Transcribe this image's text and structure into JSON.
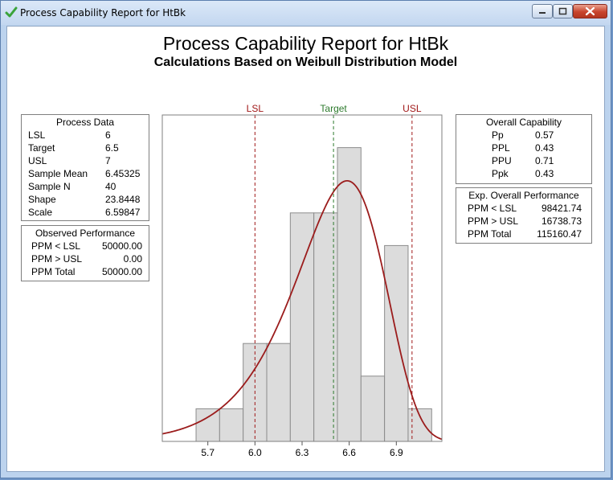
{
  "window": {
    "title": "Process Capability Report for HtBk"
  },
  "report": {
    "title": "Process Capability Report for HtBk",
    "subtitle": "Calculations Based on Weibull Distribution Model"
  },
  "process_data": {
    "title": "Process Data",
    "rows": [
      {
        "label": "LSL",
        "value": "6"
      },
      {
        "label": "Target",
        "value": "6.5"
      },
      {
        "label": "USL",
        "value": "7"
      },
      {
        "label": "Sample Mean",
        "value": "6.45325"
      },
      {
        "label": "Sample N",
        "value": "40"
      },
      {
        "label": "Shape",
        "value": "23.8448"
      },
      {
        "label": "Scale",
        "value": "6.59847"
      }
    ]
  },
  "observed_performance": {
    "title": "Observed Performance",
    "rows": [
      {
        "label": "PPM < LSL",
        "value": "50000.00"
      },
      {
        "label": "PPM > USL",
        "value": "0.00"
      },
      {
        "label": "PPM Total",
        "value": "50000.00"
      }
    ]
  },
  "overall_capability": {
    "title": "Overall Capability",
    "rows": [
      {
        "label": "Pp",
        "value": "0.57"
      },
      {
        "label": "PPL",
        "value": "0.43"
      },
      {
        "label": "PPU",
        "value": "0.71"
      },
      {
        "label": "Ppk",
        "value": "0.43"
      }
    ]
  },
  "exp_overall_performance": {
    "title": "Exp. Overall Performance",
    "rows": [
      {
        "label": "PPM < LSL",
        "value": "98421.74"
      },
      {
        "label": "PPM > USL",
        "value": "16738.73"
      },
      {
        "label": "PPM Total",
        "value": "115160.47"
      }
    ]
  },
  "chart_data": {
    "type": "bar",
    "title": "Process Capability Report for HtBk",
    "subtitle": "Calculations Based on Weibull Distribution Model",
    "bin_width": 0.15,
    "bins": [
      {
        "start": 5.625,
        "count": 1
      },
      {
        "start": 5.775,
        "count": 1
      },
      {
        "start": 5.925,
        "count": 3
      },
      {
        "start": 6.075,
        "count": 3
      },
      {
        "start": 6.225,
        "count": 7
      },
      {
        "start": 6.375,
        "count": 7
      },
      {
        "start": 6.525,
        "count": 9
      },
      {
        "start": 6.675,
        "count": 2
      },
      {
        "start": 6.825,
        "count": 6
      },
      {
        "start": 6.975,
        "count": 1
      }
    ],
    "x_ticks": [
      5.7,
      6.0,
      6.3,
      6.6,
      6.9
    ],
    "x_tick_labels": [
      "5.7",
      "6.0",
      "6.3",
      "6.6",
      "6.9"
    ],
    "xlim": [
      5.41,
      7.19
    ],
    "ylim": [
      0,
      10
    ],
    "spec_lines": [
      {
        "label": "LSL",
        "value": 6.0,
        "color": "#a01818"
      },
      {
        "label": "Target",
        "value": 6.5,
        "color": "#2d7a2d"
      },
      {
        "label": "USL",
        "value": 7.0,
        "color": "#a01818"
      }
    ],
    "fit_curve": {
      "distribution": "Weibull",
      "shape": 23.8448,
      "scale": 6.59847,
      "n": 40,
      "color": "#9b1c1c"
    },
    "bar_color": "#dcdcdc",
    "bar_edge_color": "#8c8c8c",
    "grid": false
  }
}
